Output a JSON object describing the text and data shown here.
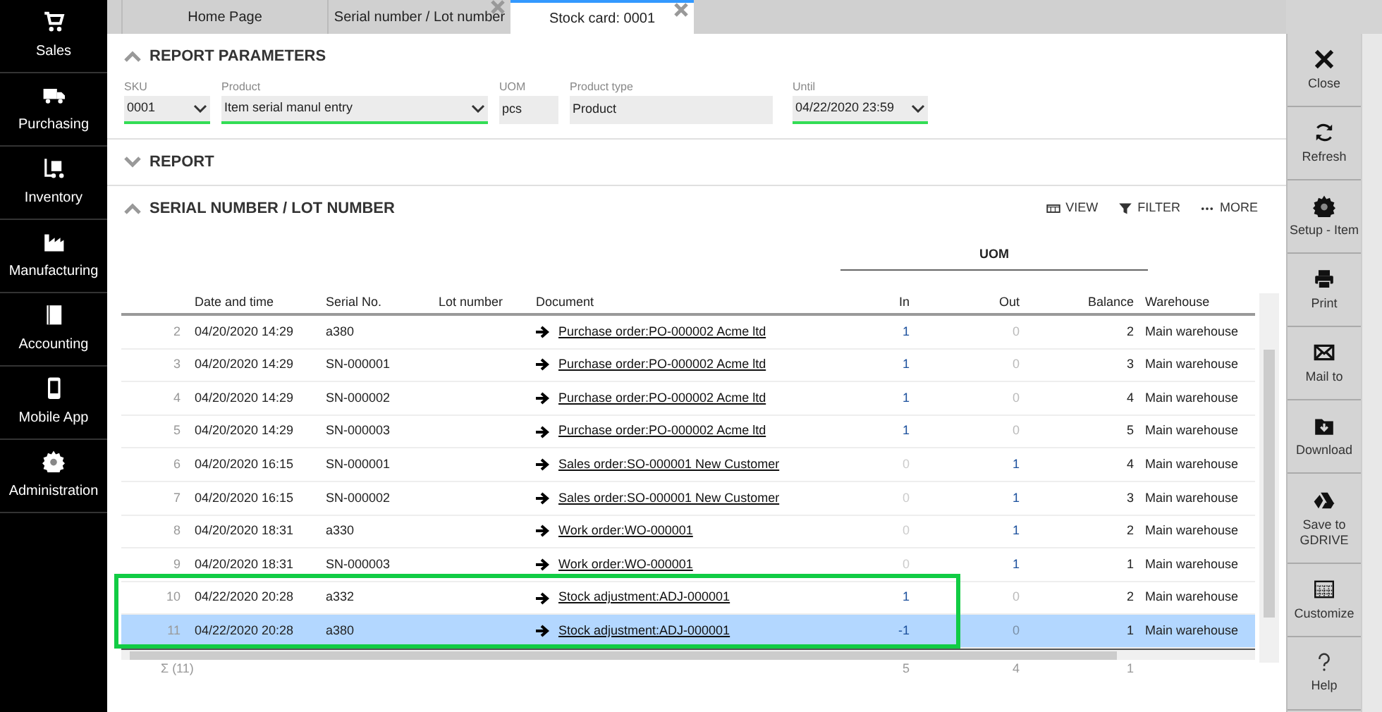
{
  "sidebar": {
    "items": [
      {
        "label": "Sales",
        "kind": "cart"
      },
      {
        "label": "Purchasing",
        "kind": "truck"
      },
      {
        "label": "Inventory",
        "kind": "forklift"
      },
      {
        "label": "Manufacturing",
        "kind": "factory"
      },
      {
        "label": "Accounting",
        "kind": "book"
      },
      {
        "label": "Mobile App",
        "kind": "phone"
      },
      {
        "label": "Administration",
        "kind": "gear"
      }
    ]
  },
  "tabs": [
    {
      "label": "Home Page",
      "selected": false,
      "closable": false
    },
    {
      "label": "Serial number / Lot number",
      "selected": false,
      "closable": true
    },
    {
      "label": "Stock card: 0001",
      "selected": true,
      "closable": true
    }
  ],
  "report_parameters": {
    "title": "REPORT PARAMETERS",
    "expanded": true,
    "fields": [
      {
        "label": "SKU",
        "value": "0001",
        "kind": "dropdown"
      },
      {
        "label": "Product",
        "value": "Item serial manul entry",
        "kind": "dropdown"
      },
      {
        "label": "UOM",
        "value": "pcs",
        "kind": "readonly"
      },
      {
        "label": "Product type",
        "value": "Product",
        "kind": "readonly"
      },
      {
        "label": "Until",
        "value": "04/22/2020 23:59",
        "kind": "dropdown"
      }
    ]
  },
  "report": {
    "title": "REPORT",
    "expanded": false
  },
  "serial_section": {
    "title": "SERIAL NUMBER / LOT NUMBER",
    "expanded": true,
    "actions": [
      {
        "label": "VIEW",
        "kind": "columns"
      },
      {
        "label": "FILTER",
        "kind": "funnel"
      },
      {
        "label": "MORE",
        "kind": "dots"
      }
    ]
  },
  "table": {
    "group_header": "UOM",
    "columns": [
      "Date and time",
      "Serial No.",
      "Lot number",
      "Document",
      "In",
      "Out",
      "Balance",
      "Warehouse"
    ],
    "rows": [
      {
        "num": "2",
        "date": "04/20/2020 14:29",
        "serial": "a380",
        "document": "Purchase order:PO-000002 Acme ltd",
        "in": {
          "text": "1",
          "dimmed": false
        },
        "out": {
          "text": "0",
          "dimmed": true
        },
        "balance": "2",
        "warehouse": "Main warehouse",
        "selected": false
      },
      {
        "num": "3",
        "date": "04/20/2020 14:29",
        "serial": "SN-000001",
        "document": "Purchase order:PO-000002 Acme ltd",
        "in": {
          "text": "1",
          "dimmed": false
        },
        "out": {
          "text": "0",
          "dimmed": true
        },
        "balance": "3",
        "warehouse": "Main warehouse",
        "selected": false
      },
      {
        "num": "4",
        "date": "04/20/2020 14:29",
        "serial": "SN-000002",
        "document": "Purchase order:PO-000002 Acme ltd",
        "in": {
          "text": "1",
          "dimmed": false
        },
        "out": {
          "text": "0",
          "dimmed": true
        },
        "balance": "4",
        "warehouse": "Main warehouse",
        "selected": false
      },
      {
        "num": "5",
        "date": "04/20/2020 14:29",
        "serial": "SN-000003",
        "document": "Purchase order:PO-000002 Acme ltd",
        "in": {
          "text": "1",
          "dimmed": false
        },
        "out": {
          "text": "0",
          "dimmed": true
        },
        "balance": "5",
        "warehouse": "Main warehouse",
        "selected": false
      },
      {
        "num": "6",
        "date": "04/20/2020 16:15",
        "serial": "SN-000001",
        "document": "Sales order:SO-000001 New Customer",
        "in": {
          "text": "0",
          "dimmed": true
        },
        "out": {
          "text": "1",
          "dimmed": false
        },
        "balance": "4",
        "warehouse": "Main warehouse",
        "selected": false
      },
      {
        "num": "7",
        "date": "04/20/2020 16:15",
        "serial": "SN-000002",
        "document": "Sales order:SO-000001 New Customer",
        "in": {
          "text": "0",
          "dimmed": true
        },
        "out": {
          "text": "1",
          "dimmed": false
        },
        "balance": "3",
        "warehouse": "Main warehouse",
        "selected": false
      },
      {
        "num": "8",
        "date": "04/20/2020 18:31",
        "serial": "a330",
        "document": "Work order:WO-000001",
        "in": {
          "text": "0",
          "dimmed": true
        },
        "out": {
          "text": "1",
          "dimmed": false
        },
        "balance": "2",
        "warehouse": "Main warehouse",
        "selected": false
      },
      {
        "num": "9",
        "date": "04/20/2020 18:31",
        "serial": "SN-000003",
        "document": "Work order:WO-000001",
        "in": {
          "text": "0",
          "dimmed": true
        },
        "out": {
          "text": "1",
          "dimmed": false
        },
        "balance": "1",
        "warehouse": "Main warehouse",
        "selected": false
      },
      {
        "num": "10",
        "date": "04/22/2020 20:28",
        "serial": "a332",
        "document": "Stock adjustment:ADJ-000001",
        "in": {
          "text": "1",
          "dimmed": false
        },
        "out": {
          "text": "0",
          "dimmed": true
        },
        "balance": "2",
        "warehouse": "Main warehouse",
        "selected": false
      },
      {
        "num": "11",
        "date": "04/22/2020 20:28",
        "serial": "a380",
        "document": "Stock adjustment:ADJ-000001",
        "in": {
          "text": "-1",
          "dimmed": false
        },
        "out": {
          "text": "0",
          "dimmed": true
        },
        "balance": "1",
        "warehouse": "Main warehouse",
        "selected": true
      }
    ],
    "totals": {
      "count": "Σ (11)",
      "in": "5",
      "out": "4",
      "balance": "1"
    }
  },
  "toolbar": [
    {
      "label": "Close",
      "kind": "x"
    },
    {
      "label": "Refresh",
      "kind": "refresh"
    },
    {
      "label": "Setup - Item",
      "kind": "gear"
    },
    {
      "label": "Print",
      "kind": "printer"
    },
    {
      "label": "Mail to",
      "kind": "mail"
    },
    {
      "label": "Download",
      "kind": "download"
    },
    {
      "label": "Save to GDRIVE",
      "kind": "drive"
    },
    {
      "label": "Customize",
      "kind": "grid"
    },
    {
      "label": "Help",
      "kind": "help"
    }
  ]
}
